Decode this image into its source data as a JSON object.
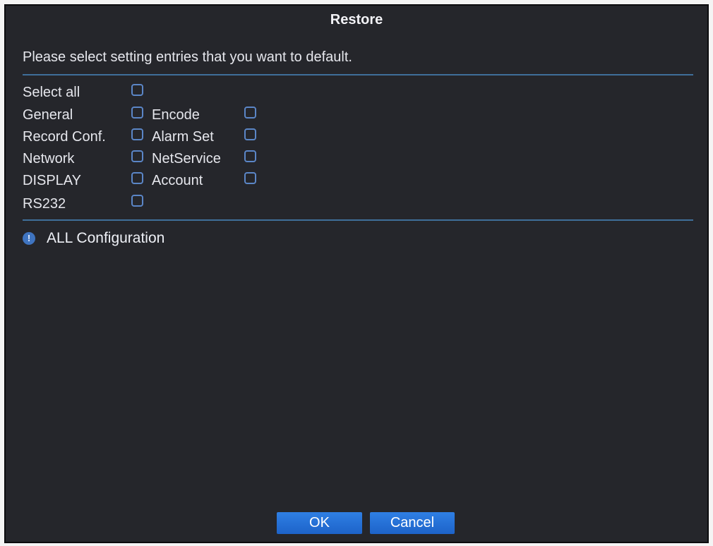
{
  "dialog": {
    "title": "Restore",
    "prompt": "Please select setting entries that you want to default."
  },
  "options": {
    "select_all": "Select all",
    "general": "General",
    "encode": "Encode",
    "record_conf": "Record Conf.",
    "alarm_set": "Alarm Set",
    "network": "Network",
    "netservice": "NetService",
    "display": "DISPLAY",
    "account": "Account",
    "rs232": "RS232"
  },
  "checked": {
    "select_all": false,
    "general": false,
    "encode": false,
    "record_conf": false,
    "alarm_set": false,
    "network": false,
    "netservice": false,
    "display": false,
    "account": false,
    "rs232": false
  },
  "info": {
    "icon": "info-icon",
    "text": "ALL Configuration"
  },
  "buttons": {
    "ok": "OK",
    "cancel": "Cancel"
  },
  "colors": {
    "background": "#25262b",
    "divider": "#3f6f9a",
    "checkbox_border": "#5b86c7",
    "button": "#2470d6"
  }
}
